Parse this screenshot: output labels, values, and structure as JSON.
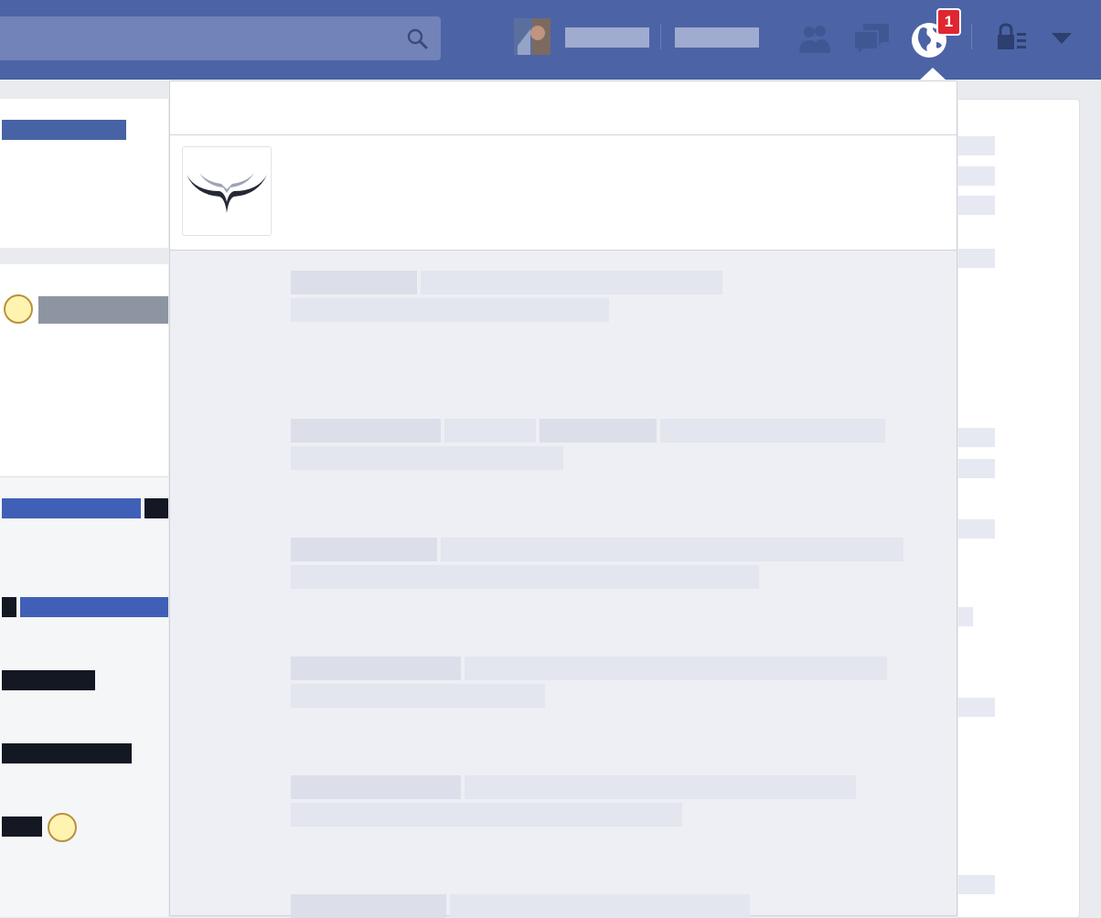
{
  "topbar": {
    "notification_count": "1",
    "search_placeholder": "",
    "icons": {
      "search": "search-icon",
      "friends": "friends-icon",
      "messages": "messages-icon",
      "notifications": "globe-icon",
      "privacy": "lock-menu-icon",
      "menu": "caret-down-icon"
    }
  },
  "colors": {
    "topbar": "#4c64a6",
    "badge": "#e02631",
    "link_blue": "#4862b6",
    "dark_text": "#141823"
  }
}
